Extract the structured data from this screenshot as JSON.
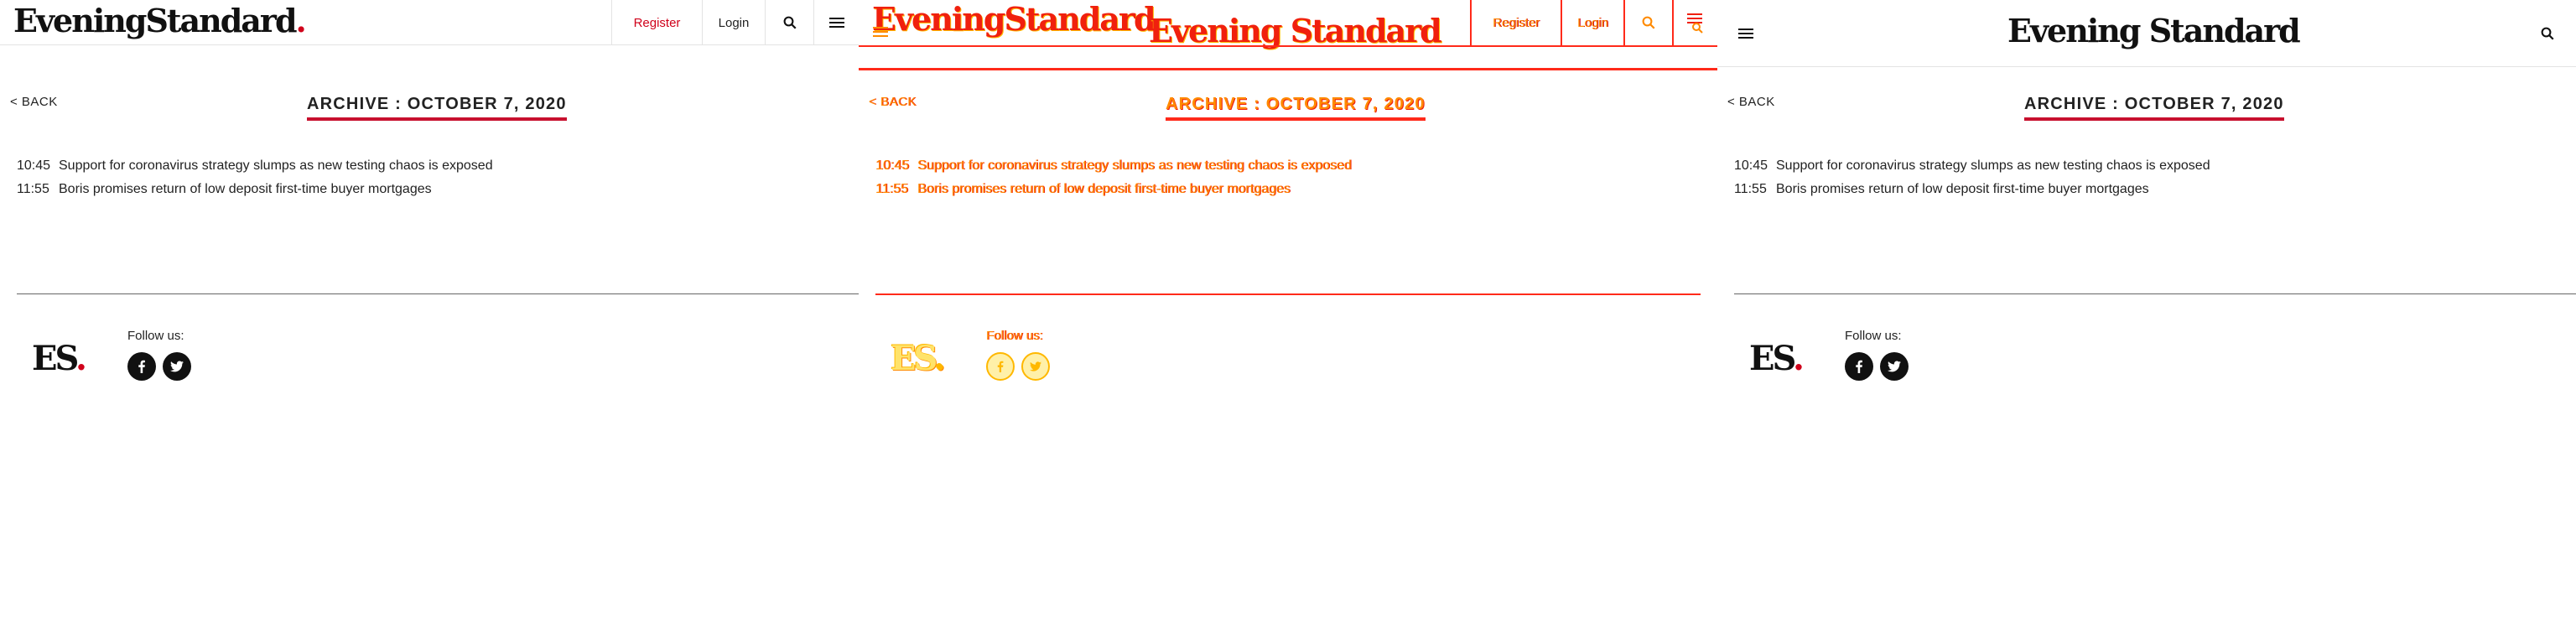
{
  "header": {
    "logo_text": "EveningStandard",
    "logo_dot": ".",
    "logo_text_spaced": "Evening Standard",
    "register_label": "Register",
    "login_label": "Login",
    "search_icon": "search-icon",
    "menu_icon": "hamburger-menu-icon"
  },
  "page": {
    "back_label": "< BACK",
    "archive_title": "ARCHIVE : OCTOBER 7, 2020"
  },
  "articles": [
    {
      "time": "10:45",
      "title": "Support for coronavirus strategy slumps as new testing chaos is exposed"
    },
    {
      "time": "11:55",
      "title": "Boris promises return of low deposit first-time buyer mortgages"
    }
  ],
  "footer": {
    "logo_text": "ES",
    "logo_dot": ".",
    "follow_label": "Follow us:",
    "social": [
      "facebook-icon",
      "twitter-icon"
    ]
  },
  "colors": {
    "brand_red": "#d0021b",
    "underline_red": "#c8102e",
    "diff_red": "#ff2a1a",
    "diff_orange": "#ff8a00",
    "diff_yellow": "#ffb800"
  }
}
